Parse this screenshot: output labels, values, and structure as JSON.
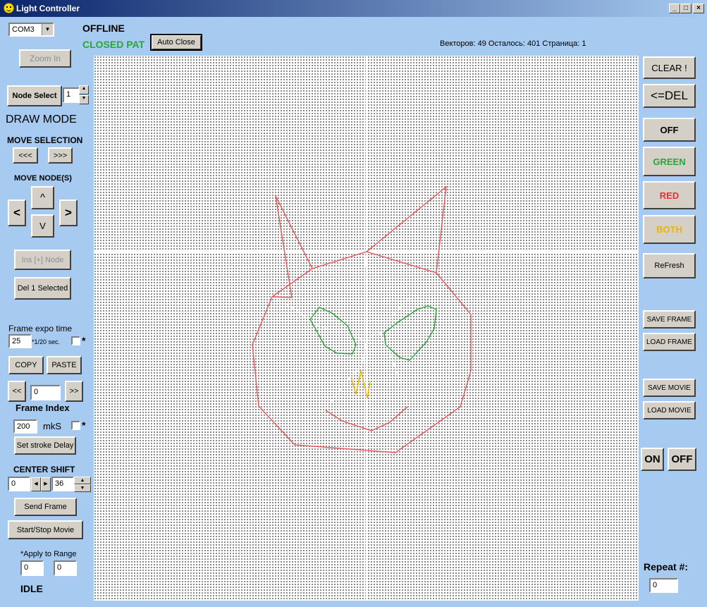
{
  "window": {
    "title": "Light Controller",
    "min": "_",
    "max": "□",
    "close": "×"
  },
  "top": {
    "com_port": "COM3",
    "com_arrow": "▼",
    "status": "OFFLINE",
    "path_mode": "CLOSED PAT",
    "auto_close": "Auto Close",
    "info": "Векторов: 49 Осталось: 401 Страница: 1"
  },
  "left": {
    "zoom_in": "Zoom In",
    "node_select": "Node Select",
    "node_index": "1",
    "draw_mode": "DRAW MODE",
    "move_selection": "MOVE SELECTION",
    "sel_left": "<<<",
    "sel_right": ">>>",
    "move_nodes": "MOVE NODE(S)",
    "up": "^",
    "left": "<",
    "right": ">",
    "down": "V",
    "ins_node": "Ins [+] Node",
    "del_selected": "Del 1 Selected",
    "frame_expo_time": "Frame expo time",
    "expo_value": "25",
    "expo_unit": "*1/20 sec.",
    "asterisk": "*",
    "copy": "COPY",
    "paste": "PASTE",
    "prev": "<<",
    "frame_value": "0",
    "next": ">>",
    "frame_index": "Frame Index",
    "delay_value": "200",
    "delay_unit": "mkS",
    "set_stroke_delay": "Set stroke Delay",
    "center_shift": "CENTER SHIFT",
    "shift_x": "0",
    "shift_y": "36",
    "send_frame": "Send Frame",
    "start_stop": "Start/Stop Movie",
    "apply_to_range": "*Apply to Range",
    "range_from": "0",
    "range_to": "0",
    "state": "IDLE"
  },
  "right": {
    "clear": "CLEAR !",
    "del": "<=DEL",
    "off": "OFF",
    "green": "GREEN",
    "red": "RED",
    "both": "BOTH",
    "refresh": "ReFresh",
    "save_frame": "SAVE FRAME",
    "load_frame": "LOAD FRAME",
    "save_movie": "SAVE MOVIE",
    "load_movie": "LOAD MOVIE",
    "on": "ON",
    "off2": "OFF",
    "repeat": "Repeat #:",
    "repeat_value": "0"
  },
  "colors": {
    "red": "#e8555a",
    "green": "#2aa53a",
    "yellow": "#f0b400",
    "white_path": "#ffffff"
  }
}
